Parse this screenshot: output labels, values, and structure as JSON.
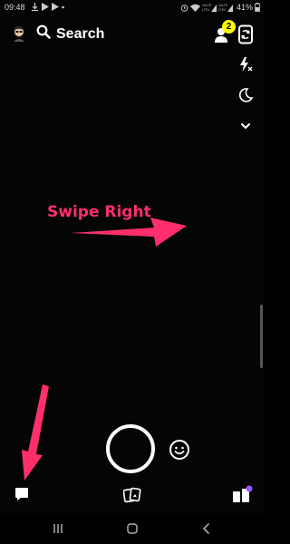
{
  "status_bar": {
    "time": "09:48",
    "network_label_1": "VoLTE LTE1",
    "network_label_2": "VoLTE LTE2",
    "battery": "41%"
  },
  "top_bar": {
    "search_label": "Search",
    "friend_badge_count": "2"
  },
  "annotation": {
    "text": "Swipe Right",
    "color": "#ff2f6d"
  },
  "colors": {
    "badge": "#fffc00",
    "accent_purple": "#9b59ff",
    "background": "#000000"
  },
  "icons": {
    "avatar": "bitmoji-avatar-icon",
    "search": "search-icon",
    "add_friend": "add-friend-icon",
    "flip": "flip-camera-icon",
    "flash": "flash-off-icon",
    "night": "night-mode-icon",
    "more": "chevron-down-icon",
    "lens": "smiley-lens-icon",
    "chat": "chat-icon",
    "memories": "memories-icon",
    "discover": "discover-icon"
  }
}
